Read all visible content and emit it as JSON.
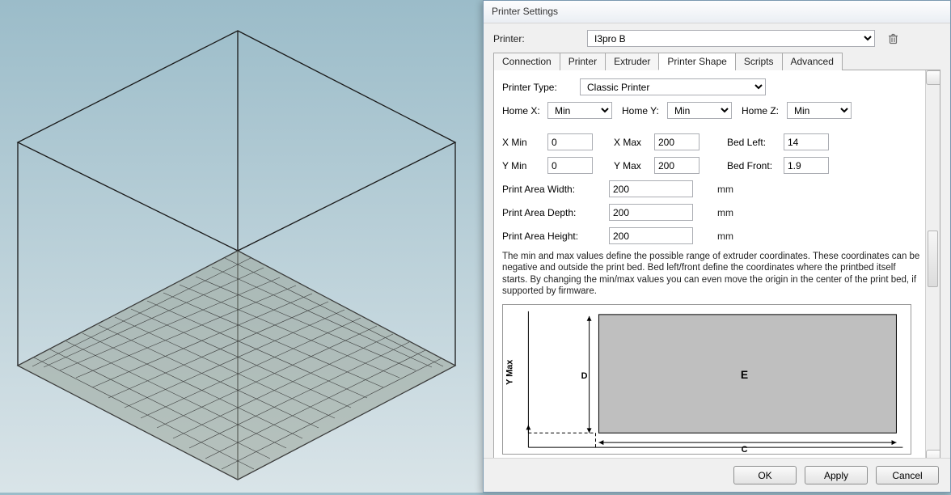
{
  "dialog": {
    "title": "Printer Settings",
    "printer_label": "Printer:",
    "printer_value": "I3pro B",
    "trash_icon": "trash-icon",
    "tabs": [
      {
        "label": "Connection"
      },
      {
        "label": "Printer"
      },
      {
        "label": "Extruder"
      },
      {
        "label": "Printer Shape"
      },
      {
        "label": "Scripts"
      },
      {
        "label": "Advanced"
      }
    ],
    "active_tab": 3,
    "pane": {
      "printer_type_label": "Printer Type:",
      "printer_type_value": "Classic Printer",
      "home_x_label": "Home X:",
      "home_x_value": "Min",
      "home_y_label": "Home Y:",
      "home_y_value": "Min",
      "home_z_label": "Home Z:",
      "home_z_value": "Min",
      "xmin_label": "X Min",
      "xmin_value": "0",
      "xmax_label": "X Max",
      "xmax_value": "200",
      "bedleft_label": "Bed Left:",
      "bedleft_value": "14",
      "ymin_label": "Y Min",
      "ymin_value": "0",
      "ymax_label": "Y Max",
      "ymax_value": "200",
      "bedfront_label": "Bed Front:",
      "bedfront_value": "1.9",
      "paw_label": "Print Area Width:",
      "paw_value": "200",
      "pad_label": "Print Area Depth:",
      "pad_value": "200",
      "pah_label": "Print Area Height:",
      "pah_value": "200",
      "unit": "mm",
      "help_text": "The min and max values define the possible range of extruder coordinates. These coordinates can be negative and outside the print bed. Bed left/front define the coordinates where the printbed itself starts. By changing the min/max values you can even move the origin in the center of the print bed, if supported by firmware.",
      "diagram": {
        "ymax": "Y Max",
        "D": "D",
        "E": "E",
        "C": "C"
      }
    },
    "buttons": {
      "ok": "OK",
      "apply": "Apply",
      "cancel": "Cancel"
    }
  }
}
